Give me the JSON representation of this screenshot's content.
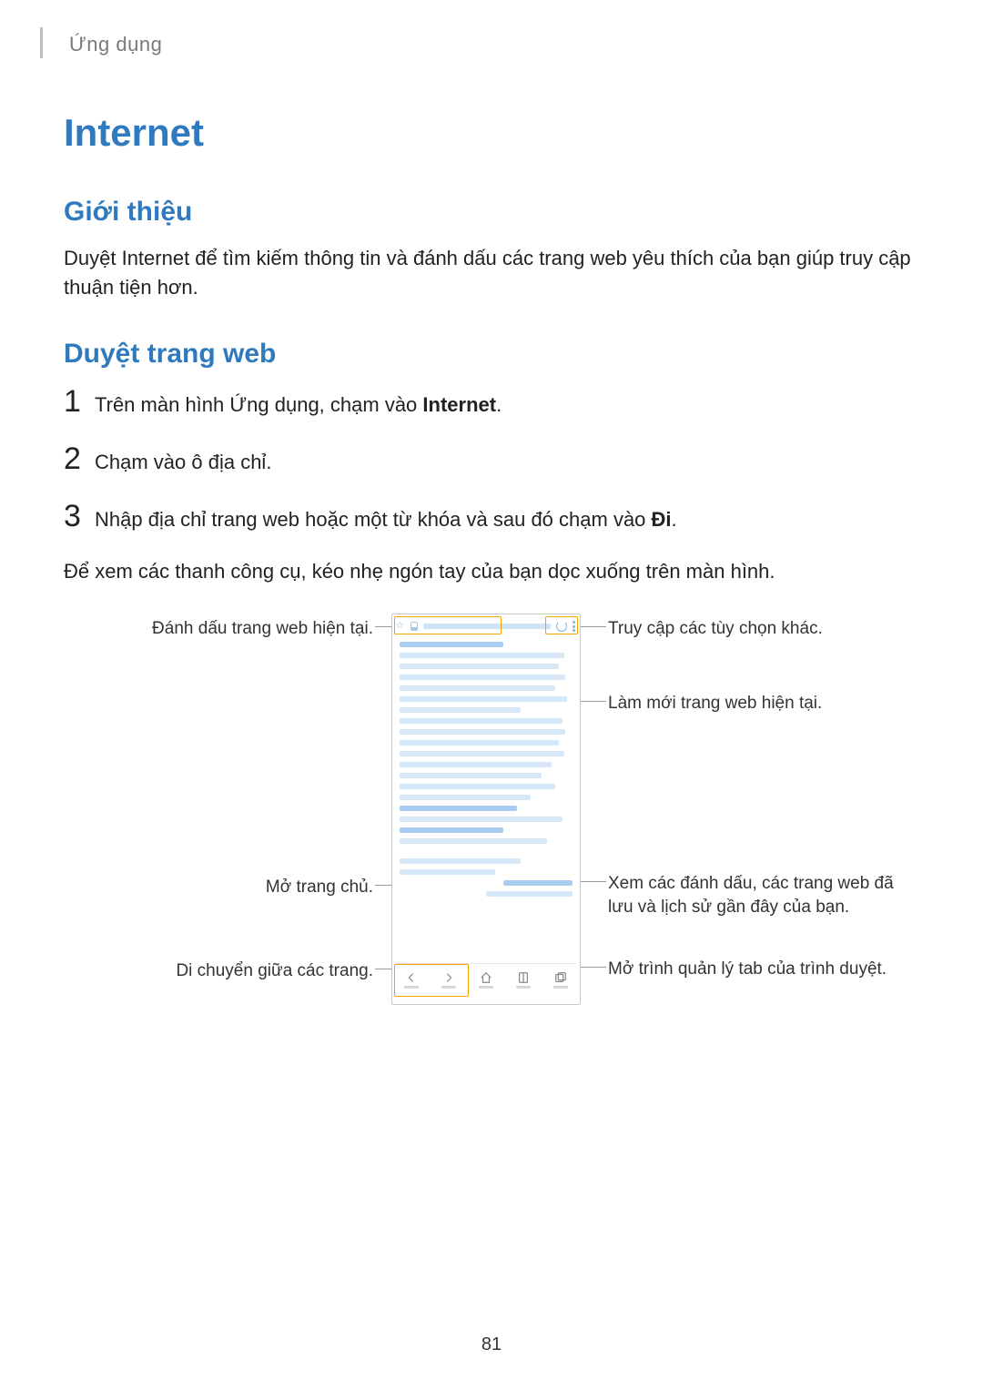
{
  "breadcrumb": "Ứng dụng",
  "title": "Internet",
  "section_intro_heading": "Giới thiệu",
  "intro_text": "Duyệt Internet để tìm kiếm thông tin và đánh dấu các trang web yêu thích của bạn giúp truy cập thuận tiện hơn.",
  "section_browse_heading": "Duyệt trang web",
  "steps": {
    "s1_num": "1",
    "s1_pre": "Trên màn hình Ứng dụng, chạm vào ",
    "s1_bold": "Internet",
    "s1_post": ".",
    "s2_num": "2",
    "s2_text": "Chạm vào ô địa chỉ.",
    "s3_num": "3",
    "s3_pre": "Nhập địa chỉ trang web hoặc một từ khóa và sau đó chạm vào ",
    "s3_bold": "Đi",
    "s3_post": "."
  },
  "after_steps": "Để xem các thanh công cụ, kéo nhẹ ngón tay của bạn dọc xuống trên màn hình.",
  "callouts": {
    "bookmark": "Đánh dấu trang web hiện tại.",
    "home": "Mở trang chủ.",
    "navigate": "Di chuyển giữa các trang.",
    "options": "Truy cập các tùy chọn khác.",
    "refresh": "Làm mới trang web hiện tại.",
    "view_bookmarks": "Xem các đánh dấu, các trang web đã lưu và lịch sử gần đây của bạn.",
    "tab_manager": "Mở trình quản lý tab của trình duyệt."
  },
  "page_number": "81"
}
